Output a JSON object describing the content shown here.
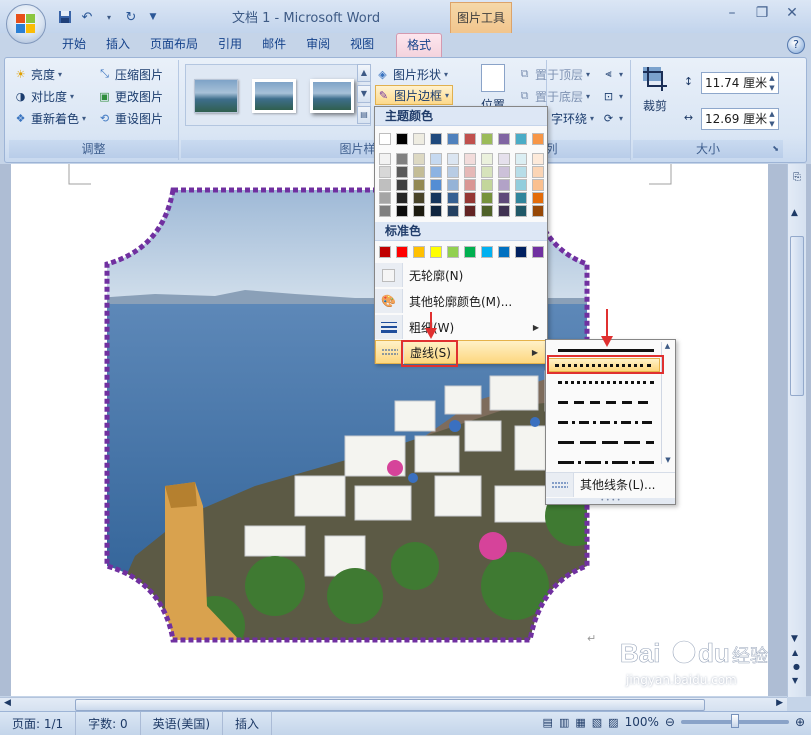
{
  "titlebar": {
    "doc_title": "文档 1 - Microsoft Word",
    "context_tab_title": "图片工具"
  },
  "tabs": [
    {
      "label": "开始"
    },
    {
      "label": "插入"
    },
    {
      "label": "页面布局"
    },
    {
      "label": "引用"
    },
    {
      "label": "邮件"
    },
    {
      "label": "审阅"
    },
    {
      "label": "视图"
    },
    {
      "label": "格式"
    }
  ],
  "ribbon": {
    "adjust": {
      "label": "调整",
      "brightness": "亮度",
      "contrast": "对比度",
      "recolor": "重新着色",
      "compress": "压缩图片",
      "change_picture": "更改图片",
      "reset_picture": "重设图片"
    },
    "picture_styles": {
      "label": "图片样式",
      "shape": "图片形状",
      "border": "图片边框"
    },
    "arrange": {
      "label": "列",
      "position": "位置",
      "bring_front": "置于顶层",
      "send_back": "置于底层",
      "text_wrap": "字环绕"
    },
    "size": {
      "label": "大小",
      "crop": "裁剪",
      "height": "11.74 厘米",
      "width": "12.69 厘米"
    }
  },
  "color_menu": {
    "theme_colors_title": "主题颜色",
    "standard_colors_title": "标准色",
    "theme_top_row": [
      "#ffffff",
      "#000000",
      "#eeece1",
      "#1f497d",
      "#4f81bd",
      "#c0504d",
      "#9bbb59",
      "#8064a2",
      "#4bacc6",
      "#f79646"
    ],
    "theme_tints": [
      [
        "#f2f2f2",
        "#808080",
        "#ddd9c3",
        "#c6d9f0",
        "#dbe5f1",
        "#f2dcdb",
        "#ebf1dd",
        "#e5e0ec",
        "#dbeef3",
        "#fdeada"
      ],
      [
        "#d8d8d8",
        "#595959",
        "#c4bd97",
        "#8db3e2",
        "#b8cce4",
        "#e5b9b7",
        "#d7e3bc",
        "#ccc1d9",
        "#b7dde8",
        "#fbd5b5"
      ],
      [
        "#bfbfbf",
        "#404040",
        "#938953",
        "#548dd4",
        "#95b3d7",
        "#d99694",
        "#c3d69b",
        "#b2a2c7",
        "#92cddc",
        "#fac08f"
      ],
      [
        "#a5a5a5",
        "#262626",
        "#494429",
        "#17365d",
        "#366092",
        "#953734",
        "#76923c",
        "#5f497a",
        "#31859b",
        "#e36c09"
      ],
      [
        "#7f7f7f",
        "#0c0c0c",
        "#1d1b10",
        "#0f243e",
        "#244061",
        "#632423",
        "#4f6128",
        "#3f3151",
        "#205867",
        "#974806"
      ]
    ],
    "standard_colors": [
      "#c00000",
      "#ff0000",
      "#ffc000",
      "#ffff00",
      "#92d050",
      "#00b050",
      "#00b0f0",
      "#0070c0",
      "#002060",
      "#7030a0"
    ],
    "no_outline": "无轮廓(N)",
    "more_colors": "其他轮廓颜色(M)...",
    "weight": "粗细(W)",
    "dashes": "虚线(S)"
  },
  "dash_menu": {
    "more_lines": "其他线条(L)..."
  },
  "statusbar": {
    "page": "页面: 1/1",
    "words": "字数: 0",
    "language": "英语(美国)",
    "insert_mode": "插入",
    "zoom": "100%"
  },
  "watermark": {
    "site": "jingyan.baidu.com"
  }
}
